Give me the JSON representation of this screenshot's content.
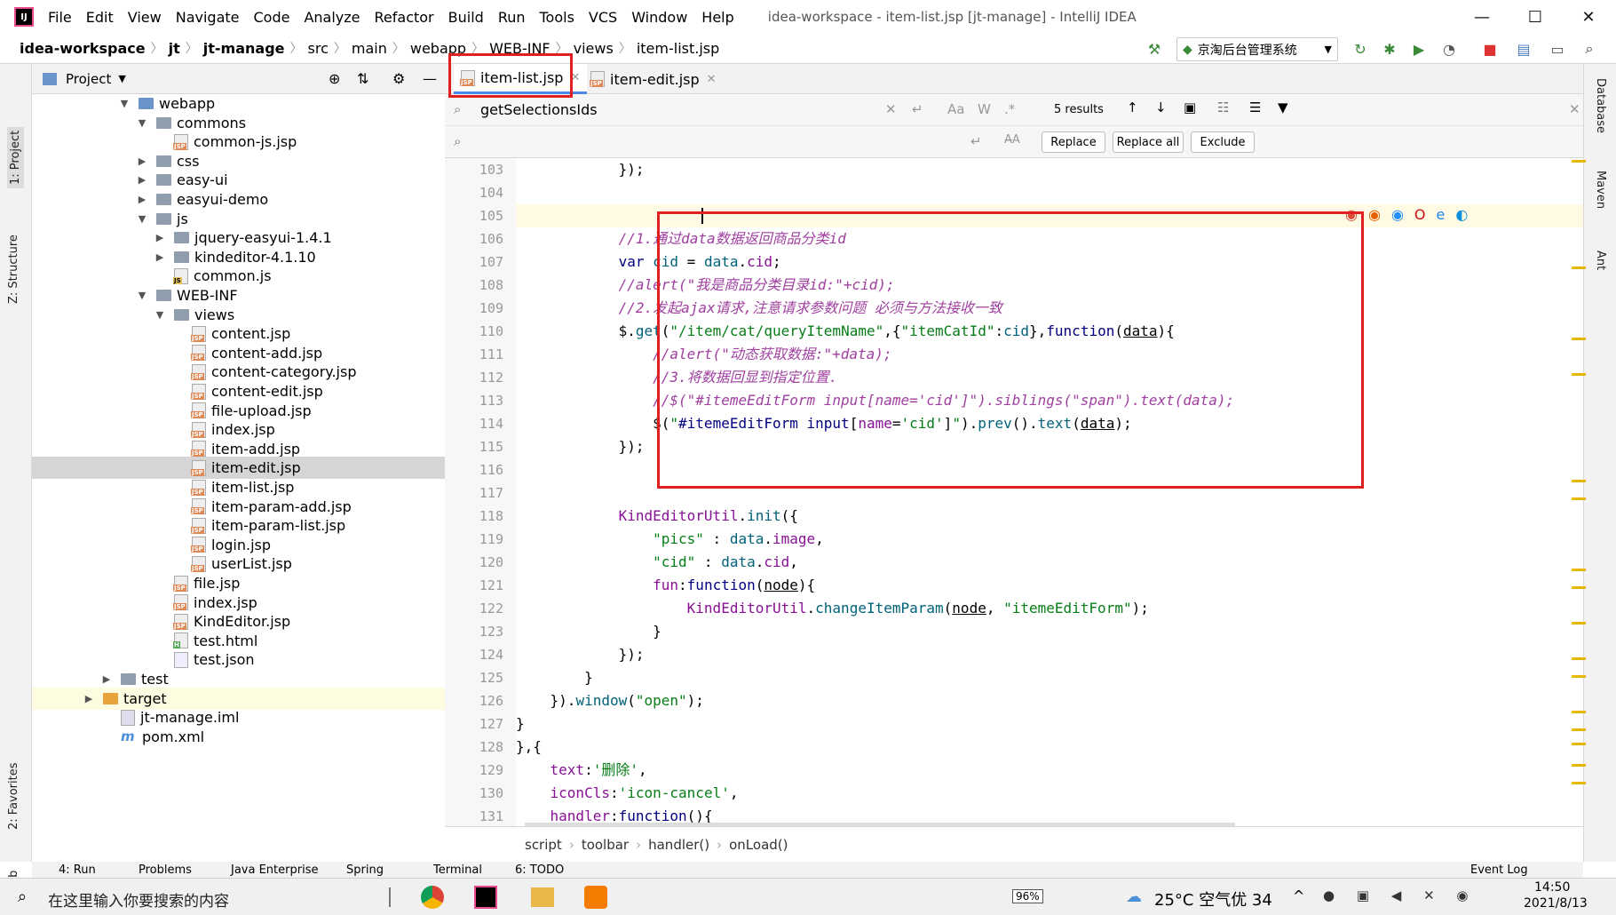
{
  "window": {
    "title": "idea-workspace - item-list.jsp [jt-manage] - IntelliJ IDEA",
    "menu": [
      "File",
      "Edit",
      "View",
      "Navigate",
      "Code",
      "Analyze",
      "Refactor",
      "Build",
      "Run",
      "Tools",
      "VCS",
      "Window",
      "Help"
    ]
  },
  "breadcrumbs": [
    "idea-workspace",
    "jt",
    "jt-manage",
    "src",
    "main",
    "webapp",
    "WEB-INF",
    "views",
    "item-list.jsp"
  ],
  "run_config": "京淘后台管理系统",
  "left_tabs": [
    "1: Project",
    "Z: Structure",
    "2: Favorites",
    "Web"
  ],
  "right_tabs": [
    "Database",
    "Maven",
    "Ant"
  ],
  "project_panel": {
    "title": "Project"
  },
  "tree": [
    {
      "label": "webapp",
      "type": "folder-blue",
      "indent": 0,
      "arrow": "▼"
    },
    {
      "label": "commons",
      "type": "folder",
      "indent": 1,
      "arrow": "▼"
    },
    {
      "label": "common-js.jsp",
      "type": "jsp",
      "indent": 2,
      "arrow": ""
    },
    {
      "label": "css",
      "type": "folder",
      "indent": 1,
      "arrow": "▶"
    },
    {
      "label": "easy-ui",
      "type": "folder",
      "indent": 1,
      "arrow": "▶"
    },
    {
      "label": "easyui-demo",
      "type": "folder",
      "indent": 1,
      "arrow": "▶"
    },
    {
      "label": "js",
      "type": "folder",
      "indent": 1,
      "arrow": "▼"
    },
    {
      "label": "jquery-easyui-1.4.1",
      "type": "folder",
      "indent": 2,
      "arrow": "▶"
    },
    {
      "label": "kindeditor-4.1.10",
      "type": "folder",
      "indent": 2,
      "arrow": "▶"
    },
    {
      "label": "common.js",
      "type": "js",
      "indent": 2,
      "arrow": ""
    },
    {
      "label": "WEB-INF",
      "type": "folder",
      "indent": 1,
      "arrow": "▼"
    },
    {
      "label": "views",
      "type": "folder",
      "indent": 2,
      "arrow": "▼"
    },
    {
      "label": "content.jsp",
      "type": "jsp",
      "indent": 3,
      "arrow": ""
    },
    {
      "label": "content-add.jsp",
      "type": "jsp",
      "indent": 3,
      "arrow": ""
    },
    {
      "label": "content-category.jsp",
      "type": "jsp",
      "indent": 3,
      "arrow": ""
    },
    {
      "label": "content-edit.jsp",
      "type": "jsp",
      "indent": 3,
      "arrow": ""
    },
    {
      "label": "file-upload.jsp",
      "type": "jsp",
      "indent": 3,
      "arrow": ""
    },
    {
      "label": "index.jsp",
      "type": "jsp",
      "indent": 3,
      "arrow": ""
    },
    {
      "label": "item-add.jsp",
      "type": "jsp",
      "indent": 3,
      "arrow": ""
    },
    {
      "label": "item-edit.jsp",
      "type": "jsp",
      "indent": 3,
      "arrow": "",
      "selected": true
    },
    {
      "label": "item-list.jsp",
      "type": "jsp",
      "indent": 3,
      "arrow": ""
    },
    {
      "label": "item-param-add.jsp",
      "type": "jsp",
      "indent": 3,
      "arrow": ""
    },
    {
      "label": "item-param-list.jsp",
      "type": "jsp",
      "indent": 3,
      "arrow": ""
    },
    {
      "label": "login.jsp",
      "type": "jsp",
      "indent": 3,
      "arrow": ""
    },
    {
      "label": "userList.jsp",
      "type": "jsp",
      "indent": 3,
      "arrow": ""
    },
    {
      "label": "file.jsp",
      "type": "jsp",
      "indent": 2,
      "arrow": ""
    },
    {
      "label": "index.jsp",
      "type": "jsp",
      "indent": 2,
      "arrow": ""
    },
    {
      "label": "KindEditor.jsp",
      "type": "jsp",
      "indent": 2,
      "arrow": ""
    },
    {
      "label": "test.html",
      "type": "html",
      "indent": 2,
      "arrow": ""
    },
    {
      "label": "test.json",
      "type": "json",
      "indent": 2,
      "arrow": ""
    },
    {
      "label": "test",
      "type": "folder",
      "indent": -1,
      "arrow": "▶"
    },
    {
      "label": "target",
      "type": "folder-orange",
      "indent": -2,
      "arrow": "▶",
      "highlight": true
    },
    {
      "label": "jt-manage.iml",
      "type": "iml",
      "indent": -1,
      "arrow": ""
    },
    {
      "label": "pom.xml",
      "type": "xml",
      "indent": -1,
      "arrow": ""
    }
  ],
  "tabs": [
    {
      "label": "item-list.jsp",
      "active": true
    },
    {
      "label": "item-edit.jsp",
      "active": false
    }
  ],
  "search": {
    "query": "getSelectionsIds",
    "results": "5 results",
    "replace_placeholder": "",
    "opts": [
      "Aa",
      "W",
      ".*"
    ],
    "replace": "Replace",
    "replace_all": "Replace all",
    "exclude": "Exclude"
  },
  "code_lines": [
    {
      "n": "103",
      "html": "            });"
    },
    {
      "n": "104",
      "html": ""
    },
    {
      "n": "105",
      "html": "            "
    },
    {
      "n": "106",
      "html": "            <span class=\"cc\">//1.通过data数据返回商品分类id</span>"
    },
    {
      "n": "107",
      "html": "            <span class=\"k\">var</span> <span class=\"f\">cid</span> = <span class=\"f\">data</span>.<span class=\"p\">cid</span>;"
    },
    {
      "n": "108",
      "html": "            <span class=\"cc\">//alert(\"我是商品分类目录id:\"+cid);</span>"
    },
    {
      "n": "109",
      "html": "            <span class=\"cc\">//2.发起ajax请求,注意请求参数问题 必须与方法接收一致</span>"
    },
    {
      "n": "110",
      "html": "            $.<span class=\"f\">get</span>(<span class=\"s\">\"/item/cat/queryItemName\"</span>,{<span class=\"s\">\"itemCatId\"</span>:<span class=\"f\">cid</span>},<span class=\"k\">function</span>(<span class=\"u\">data</span>){"
    },
    {
      "n": "111",
      "html": "                <span class=\"cc\">//alert(\"动态获取数据:\"+data);</span>"
    },
    {
      "n": "112",
      "html": "                <span class=\"cc\">//3.将数据回显到指定位置.</span>"
    },
    {
      "n": "113",
      "html": "                <span class=\"cc\">//$(\"#itemeEditForm input[name='cid']\").siblings(\"span\").text(data);</span>"
    },
    {
      "n": "114",
      "html": "                $(<span class=\"s\">\"</span><span class=\"k\">#itemeEditForm input</span>[<span class=\"p\">name</span>=<span class=\"s\">'cid'</span>]<span class=\"s\">\"</span>).<span class=\"f\">prev</span>().<span class=\"f\">text</span>(<span class=\"u\">data</span>);"
    },
    {
      "n": "115",
      "html": "            });"
    },
    {
      "n": "116",
      "html": ""
    },
    {
      "n": "117",
      "html": ""
    },
    {
      "n": "118",
      "html": "            <span class=\"p\">KindEditorUtil</span>.<span class=\"f\">init</span>({"
    },
    {
      "n": "119",
      "html": "                <span class=\"s\">\"pics\"</span> : <span class=\"f\">data</span>.<span class=\"p\">image</span>,"
    },
    {
      "n": "120",
      "html": "                <span class=\"s\">\"cid\"</span> : <span class=\"f\">data</span>.<span class=\"p\">cid</span>,"
    },
    {
      "n": "121",
      "html": "                <span class=\"p\">fun</span>:<span class=\"k\">function</span>(<span class=\"u\">node</span>){"
    },
    {
      "n": "122",
      "html": "                    <span class=\"p\">KindEditorUtil</span>.<span class=\"f\">changeItemParam</span>(<span class=\"u\">node</span>, <span class=\"s\">\"itemeEditForm\"</span>);"
    },
    {
      "n": "123",
      "html": "                }"
    },
    {
      "n": "124",
      "html": "            });"
    },
    {
      "n": "125",
      "html": "        }"
    },
    {
      "n": "126",
      "html": "    }).<span class=\"f\">window</span>(<span class=\"s\">\"open\"</span>);"
    },
    {
      "n": "127",
      "html": "}"
    },
    {
      "n": "128",
      "html": "},{"
    },
    {
      "n": "129",
      "html": "    <span class=\"p\">text</span>:<span class=\"s\">'删除'</span>,"
    },
    {
      "n": "130",
      "html": "    <span class=\"p\">iconCls</span>:<span class=\"s\">'icon-cancel'</span>,"
    },
    {
      "n": "131",
      "html": "    <span class=\"p\">handler</span>:<span class=\"k\">function</span>(){"
    }
  ],
  "code_breadcrumb": [
    "script",
    "toolbar",
    "handler()",
    "onLoad()"
  ],
  "tool_windows": [
    "4: Run",
    "Problems",
    "Java Enterprise",
    "Spring",
    "Terminal",
    "6: TODO",
    "Event Log"
  ],
  "taskbar": {
    "search_placeholder": "在这里输入你要搜索的内容",
    "battery": "96%",
    "weather": "25°C  空气优 34",
    "time": "14:50",
    "date": "2021/8/13"
  }
}
